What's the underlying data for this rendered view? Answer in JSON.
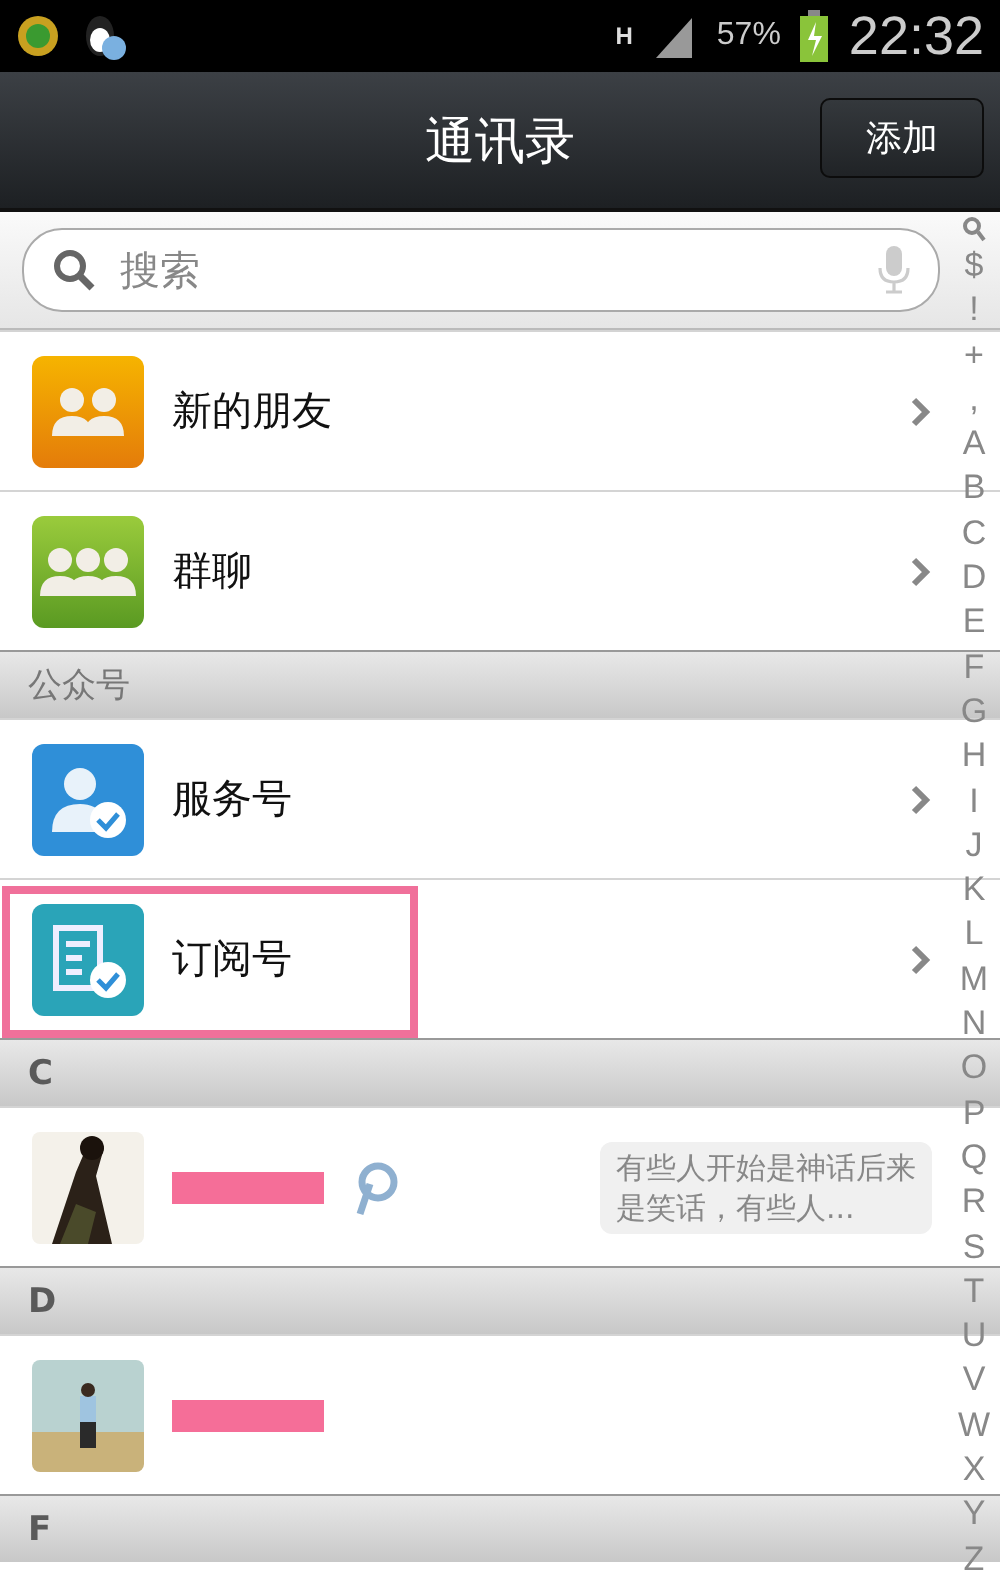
{
  "status_bar": {
    "network": "H",
    "battery": "57%",
    "time": "22:32"
  },
  "title_bar": {
    "title": "通讯录",
    "action": "添加"
  },
  "search": {
    "placeholder": "搜索"
  },
  "sections": [
    {
      "rows": [
        {
          "kind": "friends",
          "label": "新的朋友",
          "highlighted": false
        },
        {
          "kind": "group",
          "label": "群聊",
          "highlighted": false
        }
      ]
    },
    {
      "header": "公众号",
      "rows": [
        {
          "kind": "service",
          "label": "服务号",
          "highlighted": false
        },
        {
          "kind": "subscription",
          "label": "订阅号",
          "highlighted": true
        }
      ]
    },
    {
      "header": "C",
      "rows": [
        {
          "kind": "contact",
          "name_redacted": true,
          "badge": true,
          "signature": "有些人开始是神话后来是笑话，有些人..."
        }
      ]
    },
    {
      "header": "D",
      "rows": [
        {
          "kind": "contact",
          "name_redacted": true
        }
      ]
    },
    {
      "header": "F"
    }
  ],
  "index": [
    "$",
    "!",
    "+",
    ",",
    "A",
    "B",
    "C",
    "D",
    "E",
    "F",
    "G",
    "H",
    "I",
    "J",
    "K",
    "L",
    "M",
    "N",
    "O",
    "P",
    "Q",
    "R",
    "S",
    "T",
    "U",
    "V",
    "W",
    "X",
    "Y",
    "Z"
  ]
}
